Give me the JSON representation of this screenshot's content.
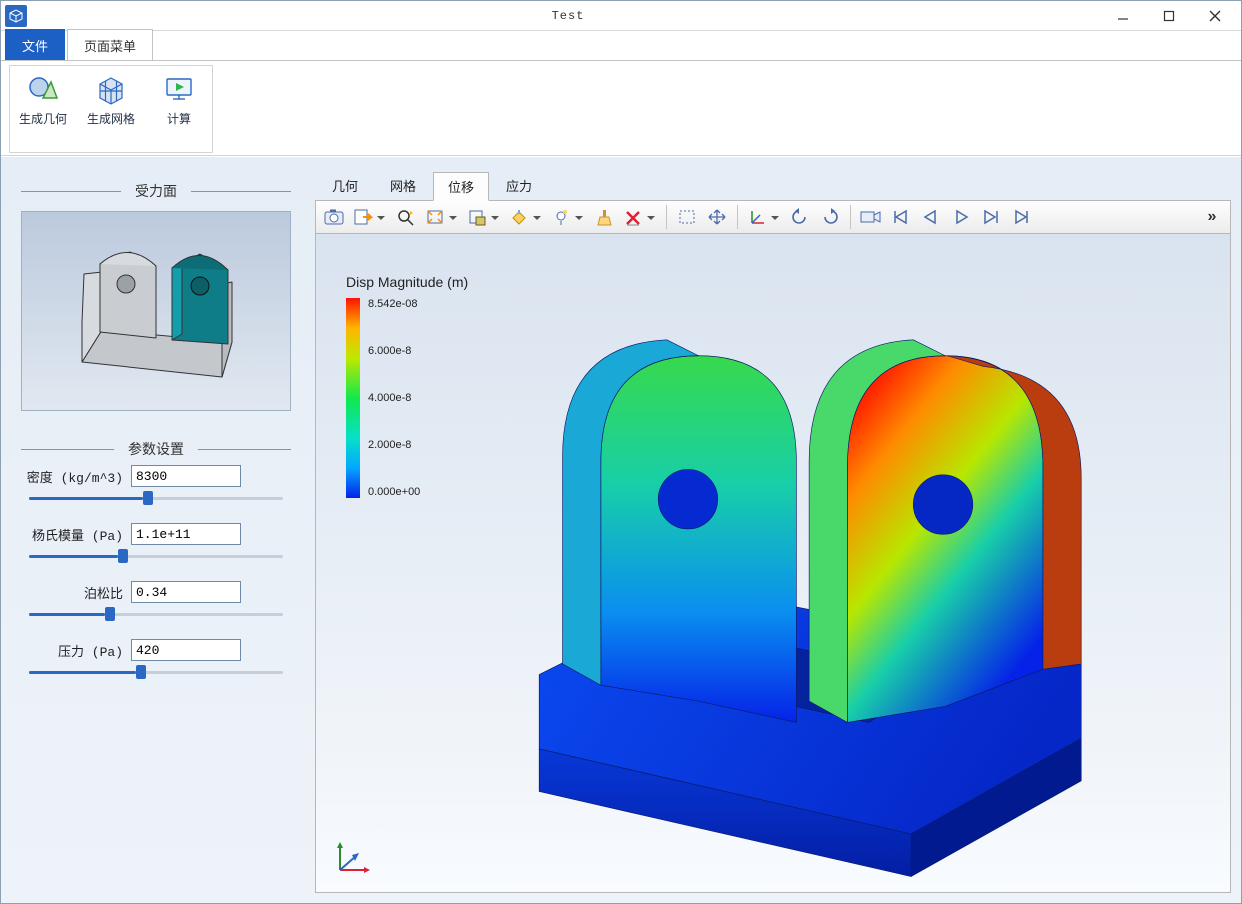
{
  "window": {
    "title": "Test"
  },
  "menu": {
    "file": "文件",
    "page": "页面菜单"
  },
  "ribbon": {
    "geom": "生成几何",
    "mesh": "生成网格",
    "solve": "计算"
  },
  "sidebar": {
    "face_title": "受力面",
    "params_title": "参数设置",
    "density_label": "密度 (kg/m^3)",
    "density_value": "8300",
    "young_label": "杨氏模量 (Pa)",
    "young_value": "1.1e+11",
    "poisson_label": "泊松比",
    "poisson_value": "0.34",
    "pressure_label": "压力 (Pa)",
    "pressure_value": "420"
  },
  "viewtabs": {
    "geom": "几何",
    "mesh": "网格",
    "disp": "位移",
    "stress": "应力"
  },
  "legend": {
    "title": "Disp Magnitude (m)",
    "max": "8.542e-08",
    "t3": "6.000e-8",
    "t2": "4.000e-8",
    "t1": "2.000e-8",
    "min": "0.000e+00"
  },
  "toolbar_more": "»"
}
